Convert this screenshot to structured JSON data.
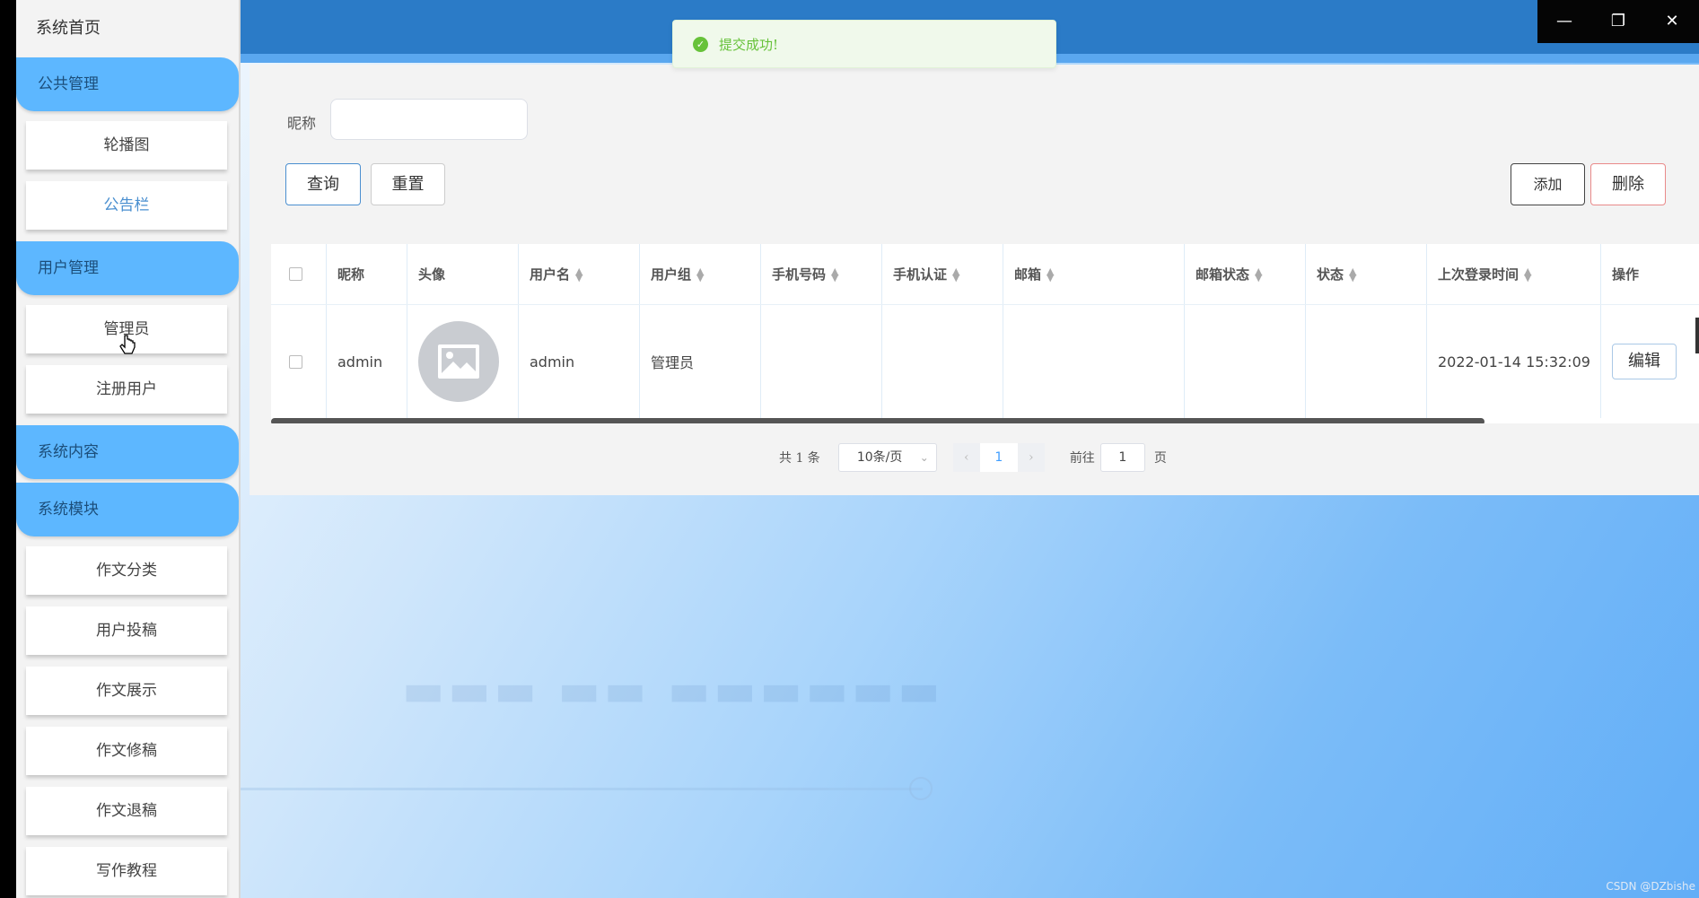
{
  "sidebar": {
    "home": "系统首页",
    "groups": [
      {
        "label": "公共管理",
        "items": [
          "轮播图",
          "公告栏"
        ]
      },
      {
        "label": "用户管理",
        "items": [
          "管理员",
          "注册用户"
        ]
      },
      {
        "label": "系统内容",
        "items": []
      },
      {
        "label": "系统模块",
        "items": [
          "作文分类",
          "用户投稿",
          "作文展示",
          "作文修稿",
          "作文退稿",
          "写作教程"
        ]
      }
    ]
  },
  "toast": {
    "message": "提交成功!"
  },
  "window": {
    "minimize": "—",
    "restore": "❐",
    "close": "✕"
  },
  "search": {
    "label": "昵称",
    "value": ""
  },
  "buttons": {
    "query": "查询",
    "reset": "重置",
    "add": "添加",
    "delete": "删除",
    "edit": "编辑"
  },
  "table": {
    "columns": [
      "昵称",
      "头像",
      "用户名",
      "用户组",
      "手机号码",
      "手机认证",
      "邮箱",
      "邮箱状态",
      "状态",
      "上次登录时间",
      "操作"
    ],
    "rows": [
      {
        "nickname": "admin",
        "username": "admin",
        "group": "管理员",
        "phone": "",
        "phone_verified": "",
        "email": "",
        "email_status": "",
        "status": "",
        "last_login": "2022-01-14 15:32:09"
      }
    ]
  },
  "pagination": {
    "total": "共 1 条",
    "page_size": "10条/页",
    "current_page": "1",
    "goto_label": "前往",
    "goto_value": "1",
    "page_suffix": "页"
  },
  "watermark": "CSDN @DZbishe",
  "colors": {
    "topbar": "#2b7bc7",
    "sidebar_group": "#5db7ff",
    "toast_green": "#67c23a",
    "primary": "#409eff"
  }
}
